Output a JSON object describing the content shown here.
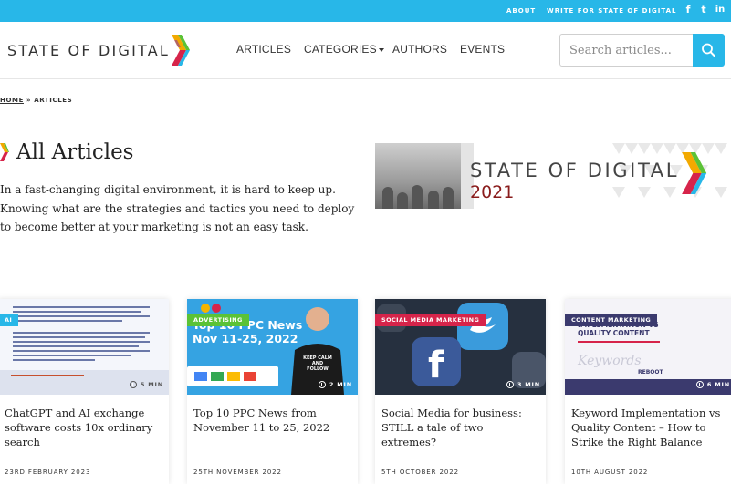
{
  "topbar": {
    "about": "ABOUT",
    "write": "WRITE FOR STATE OF DIGITAL",
    "social": [
      "facebook-icon",
      "twitter-icon",
      "linkedin-icon"
    ],
    "social_glyphs": [
      "f",
      "t",
      "in"
    ],
    "bg": "#28b7e8"
  },
  "header": {
    "logo": "STATE OF DIGITAL",
    "nav": [
      "ARTICLES",
      "CATEGORIES",
      "AUTHORS",
      "EVENTS"
    ],
    "search_placeholder": "Search articles..."
  },
  "breadcrumb": {
    "home": "HOME",
    "sep": "»",
    "current": "ARTICLES"
  },
  "hero": {
    "title": "All Articles",
    "intro": "In a fast-changing digital environment, it is hard to keep up. Knowing what are the strategies and tactics you need to deploy to become better at your marketing is not an easy task.",
    "banner_brand": "STATE OF DIGITAL",
    "banner_year": "2021"
  },
  "cards": [
    {
      "tag": "AI",
      "tag_color": "#28b7e8",
      "readtime": "5 MIN",
      "title": "ChatGPT and AI exchange software costs 10x ordinary search",
      "date": "23RD FEBRUARY 2023"
    },
    {
      "tag": "ADVERTISING",
      "tag_color": "#5bc236",
      "readtime": "2 MIN",
      "title": "Top 10 PPC News from November 11 to 25, 2022",
      "date": "25TH NOVEMBER 2022",
      "thumb_heading": "Top 10 PPC News",
      "thumb_dates": "Nov 11-25, 2022",
      "shirt_text": "KEEP CALM AND FOLLOW"
    },
    {
      "tag": "SOCIAL MEDIA MARKETING",
      "tag_color": "#d6244a",
      "readtime": "3 MIN",
      "title": "Social Media for business: STILL a tale of two extremes?",
      "date": "5TH OCTOBER 2022"
    },
    {
      "tag": "CONTENT MARKETING",
      "tag_color": "#3b3a6e",
      "readtime": "6 MIN",
      "title": "Keyword Implementation vs Quality Content – How to Strike the Right Balance",
      "date": "10TH AUGUST 2022",
      "thumb_heading": "IMPLEMENTATION VS QUALITY CONTENT",
      "thumb_brand": "REBOOT",
      "thumb_word": "Keywords"
    }
  ]
}
